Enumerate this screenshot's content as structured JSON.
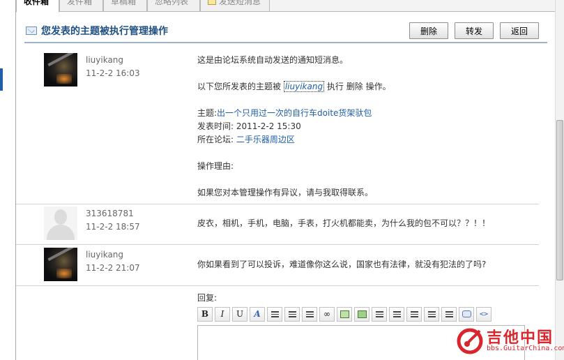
{
  "tabs": [
    {
      "label": "收件箱",
      "active": true
    },
    {
      "label": "发件箱",
      "active": false
    },
    {
      "label": "草稿箱",
      "active": false
    },
    {
      "label": "忽略列表",
      "active": false
    },
    {
      "label": "发送短消息",
      "active": false,
      "icon": "compose-icon"
    }
  ],
  "header": {
    "title": "您发表的主题被执行管理操作",
    "buttons": {
      "delete": "删除",
      "forward": "转发",
      "back": "返回"
    }
  },
  "messages": [
    {
      "author": "liuyikang",
      "time": "11-2-2 16:03",
      "avatar": "guitar-photo",
      "intro": "这是由论坛系统自动发送的通知短消息。",
      "op_prefix": "以下您所发表的主题被",
      "op_user": "liuyikang",
      "op_mid": "执行",
      "op_action": "删除",
      "op_suffix": "操作。",
      "subject_label": "主题:",
      "subject": "出一个只用过一次的自行车doite货架驮包",
      "posttime_label": "发表时间:",
      "posttime": "2011-2-2 15:30",
      "forum_label": "所在论坛:",
      "forum": "二手乐器周边区",
      "reason_label": "操作理由:",
      "footer": "如果您对本管理操作有异议，请与我取得联系。"
    },
    {
      "author": "313618781",
      "time": "11-2-2 18:57",
      "avatar": "default-user",
      "text": "皮衣，相机，手机，电脑，手表，打火机都能卖，为什么我的包不可以？？！！"
    },
    {
      "author": "liuyikang",
      "time": "11-2-2 21:07",
      "avatar": "guitar-photo",
      "text": "你如果看到了可以投诉，难道像你这么说，国家也有法律，就没有犯法的了吗?"
    }
  ],
  "reply": {
    "label": "回复:",
    "toolbar": [
      "bold",
      "italic",
      "underline",
      "font-color",
      "align-left",
      "align-center",
      "align-right",
      "link",
      "image",
      "media",
      "ordered-list",
      "unordered-list",
      "indent",
      "outdent",
      "float",
      "quote",
      "code"
    ]
  },
  "watermark": {
    "title": "吉他中国",
    "url": "bbs.GuitarChina.com"
  },
  "colors": {
    "accent": "#1f4f82",
    "link": "#1f5fa8",
    "brand": "#d9262c"
  }
}
